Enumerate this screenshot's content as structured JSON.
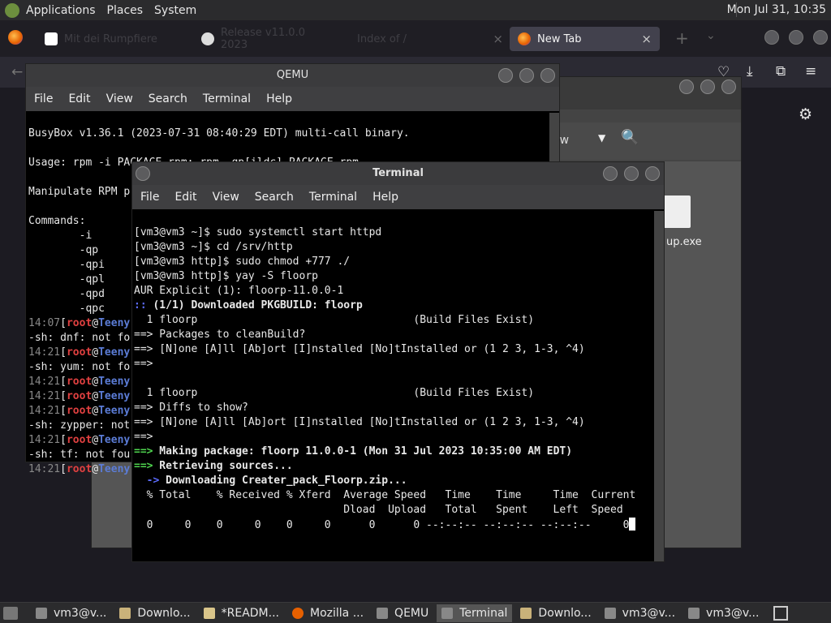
{
  "top_panel": {
    "menus": [
      "Applications",
      "Places",
      "System"
    ],
    "clock": "Mon Jul 31, 10:35"
  },
  "firefox": {
    "tabs": [
      {
        "label": "Mit dei Rumpfiere"
      },
      {
        "label": "Release v11.0.0 2023"
      },
      {
        "label": "Index of /"
      },
      {
        "label": "New Tab"
      }
    ],
    "close_label": "×"
  },
  "qemu": {
    "title": "QEMU",
    "menu": [
      "File",
      "Edit",
      "View",
      "Search",
      "Terminal",
      "Help"
    ],
    "lines": [
      "BusyBox v1.36.1 (2023-07-31 08:40:29 EDT) multi-call binary.",
      "",
      "Usage: rpm -i PACKAGE.rpm; rpm -qp[ildc] PACKAGE.rpm",
      "",
      "Manipulate RPM p",
      "",
      "Commands:",
      "        -i",
      "        -qp",
      "        -qpi",
      "        -qpl",
      "        -qpd",
      "        -qpc"
    ],
    "prompt_lines": [
      {
        "time": "14:07",
        "user": "root",
        "host": "Teeny"
      },
      {
        "text": "-sh: dnf: not fo"
      },
      {
        "time": "14:21",
        "user": "root",
        "host": "Teeny"
      },
      {
        "text": "-sh: yum: not fo"
      },
      {
        "time": "14:21",
        "user": "root",
        "host": "Teeny"
      },
      {
        "time": "14:21",
        "user": "root",
        "host": "Teeny"
      },
      {
        "time": "14:21",
        "user": "root",
        "host": "Teeny"
      },
      {
        "text": "-sh: zypper: not"
      },
      {
        "time": "14:21",
        "user": "root",
        "host": "Teeny"
      },
      {
        "text": "-sh: tf: not fou"
      },
      {
        "time": "14:21",
        "user": "root",
        "host": "Teeny"
      }
    ]
  },
  "file_manager": {
    "view_label": "ew",
    "file_label": "up.exe"
  },
  "terminal": {
    "title": "Terminal",
    "menu": [
      "File",
      "Edit",
      "View",
      "Search",
      "Terminal",
      "Help"
    ],
    "l1": "[vm3@vm3 ~]$ sudo systemctl start httpd",
    "l2": "[vm3@vm3 ~]$ cd /srv/http",
    "l3": "[vm3@vm3 http]$ sudo chmod +777 ./",
    "l4": "[vm3@vm3 http]$ yay -S floorp",
    "l5": "AUR Explicit (1): floorp-11.0.0-1",
    "l6a": ":: ",
    "l6b": "(1/1) Downloaded PKGBUILD: floorp",
    "l7": "  1 floorp                                  (Build Files Exist)",
    "l8a": "==>",
    "l8b": " Packages to cleanBuild?",
    "l9a": "==>",
    "l9b": " [N]one [A]ll [Ab]ort [I]nstalled [No]tInstalled or (1 2 3, 1-3, ^4)",
    "l10": "==>",
    "l11": "",
    "l12": "  1 floorp                                  (Build Files Exist)",
    "l13a": "==>",
    "l13b": " Diffs to show?",
    "l14a": "==>",
    "l14b": " [N]one [A]ll [Ab]ort [I]nstalled [No]tInstalled or (1 2 3, 1-3, ^4)",
    "l15": "==>",
    "l16a": "==>",
    "l16b": " Making package: floorp 11.0.0-1 (Mon 31 Jul 2023 10:35:00 AM EDT)",
    "l17a": "==>",
    "l17b": " Retrieving sources...",
    "l18a": "  ->",
    "l18b": " Downloading Creater_pack_Floorp.zip...",
    "l19": "  % Total    % Received % Xferd  Average Speed   Time    Time     Time  Current",
    "l20": "                                 Dload  Upload   Total   Spent    Left  Speed",
    "l21": "  0     0    0     0    0     0      0      0 --:--:-- --:--:-- --:--:--     0"
  },
  "taskbar": {
    "items": [
      {
        "label": "vm3@v..."
      },
      {
        "label": "Downlo..."
      },
      {
        "label": "*READM..."
      },
      {
        "label": "Mozilla ..."
      },
      {
        "label": "QEMU"
      },
      {
        "label": "Terminal"
      },
      {
        "label": "Downlo..."
      },
      {
        "label": "vm3@v..."
      },
      {
        "label": "vm3@v..."
      }
    ]
  }
}
